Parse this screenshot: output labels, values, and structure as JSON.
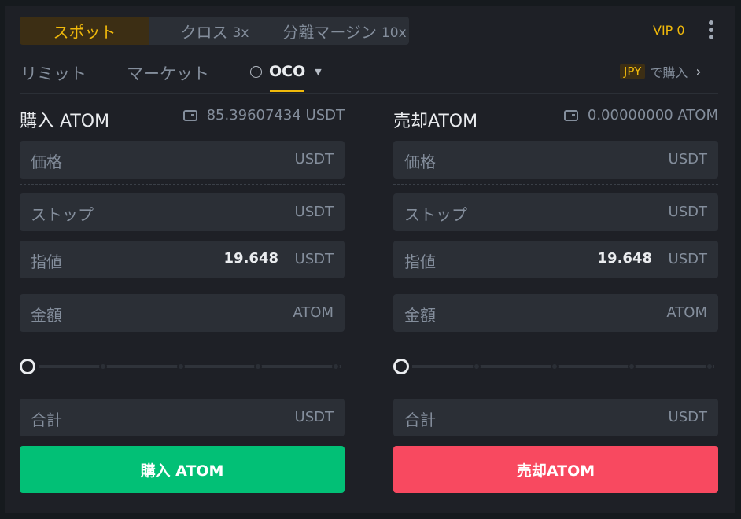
{
  "mode_tabs": {
    "spot": "スポット",
    "cross": "クロス",
    "cross_leverage": "3x",
    "isolated": "分離マージン",
    "isolated_leverage": "10x"
  },
  "vip": "VIP 0",
  "order_tabs": {
    "limit": "リミット",
    "market": "マーケット",
    "oco": "OCO",
    "active": "oco"
  },
  "jpy_buy": {
    "badge": "JPY",
    "text": "で購入"
  },
  "buy": {
    "title": "購入 ATOM",
    "balance": "85.39607434 USDT",
    "price_label": "価格",
    "price_unit": "USDT",
    "stop_label": "ストップ",
    "stop_unit": "USDT",
    "limit_label": "指値",
    "limit_value": "19.648",
    "limit_unit": "USDT",
    "amount_label": "金額",
    "amount_unit": "ATOM",
    "slider_percent": 0,
    "total_label": "合計",
    "total_unit": "USDT",
    "button": "購入 ATOM"
  },
  "sell": {
    "title": "売却ATOM",
    "balance": "0.00000000 ATOM",
    "price_label": "価格",
    "price_unit": "USDT",
    "stop_label": "ストップ",
    "stop_unit": "USDT",
    "limit_label": "指値",
    "limit_value": "19.648",
    "limit_unit": "USDT",
    "amount_label": "金額",
    "amount_unit": "ATOM",
    "slider_percent": 0,
    "total_label": "合計",
    "total_unit": "USDT",
    "button": "売却ATOM"
  },
  "colors": {
    "accent": "#f0b90b",
    "buy": "#02c076",
    "sell": "#f84960",
    "background": "#1e2026",
    "input": "#2b2f36"
  }
}
